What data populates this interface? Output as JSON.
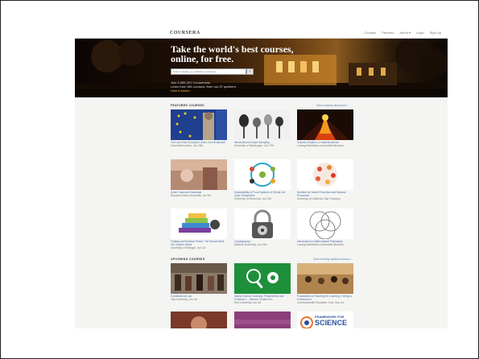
{
  "topbar": {
    "logo": "COURSERA",
    "nav": [
      "Courses",
      "Partners",
      "About ▾",
      "Login",
      "Sign Up"
    ]
  },
  "hero": {
    "title_line1": "Take the world's best courses,",
    "title_line2": "online, for free.",
    "search_placeholder": "Search catalog (e.g. Machine Learning)",
    "search_button": "⌕",
    "stat_line1": "Join 5,386,331 Courserians.",
    "stat_line2": "Learn from 581 courses, from our 87 partners.",
    "link": "How it works ›"
  },
  "sections": {
    "featured_label": "FEATURED COURSES",
    "featured_link": "View recently launched »",
    "upcoming_label": "UPCOMING COURSES",
    "upcoming_link": "View recently added courses »"
  },
  "featured": [
    {
      "title": "The Law of the European Union: An Introduction",
      "school": "Universiteit Leiden, Jun 15th"
    },
    {
      "title": "Introduction to Music Sampling",
      "school": "University of Washington, Jun 17th"
    },
    {
      "title": "Volcanic Eruption: a material science",
      "school": "Ludwig-Maximilians-Universität München"
    },
    {
      "title": "Dutch Grammar Essentials",
      "school": "Ruprecht-Karls-Universität, Jun 3rd"
    },
    {
      "title": "Sustainability of Food Systems: A Global Life Cycle Perspective",
      "school": "University of Minnesota, Jun 3rd"
    },
    {
      "title": "Nutrition for Health Promotion and Disease Prevention",
      "school": "University of California, San Francisco"
    },
    {
      "title": "Fantasy and Science Fiction: The Human Mind, Our Modern World",
      "school": "University of Michigan, Jun 1st"
    },
    {
      "title": "Cryptography I",
      "school": "Stanford University, Jun 15th"
    },
    {
      "title": "Introduction to Mathematical Philosophy",
      "school": "Ludwig-Maximilians-Universität München"
    }
  ],
  "upcoming": [
    {
      "title": "Constitutional Law",
      "school": "Yale University, Jun 1st"
    },
    {
      "title": "Inquiry Science Learning: Perspectives and Practices 1 - Science Content Kn...",
      "school": "Rice University, Jun 1st"
    },
    {
      "title": "Foundations of Teaching for Learning 1: Being a Professional",
      "school": "Commonwealth Education Trust, Sep 1st"
    }
  ],
  "framework_text_top": "FRAMEWORK FOR",
  "framework_text_big": "SCIENCE",
  "colors": {
    "accent": "#f3c24a",
    "link": "#4a6fa5",
    "hero_bg": "#1f1007"
  }
}
